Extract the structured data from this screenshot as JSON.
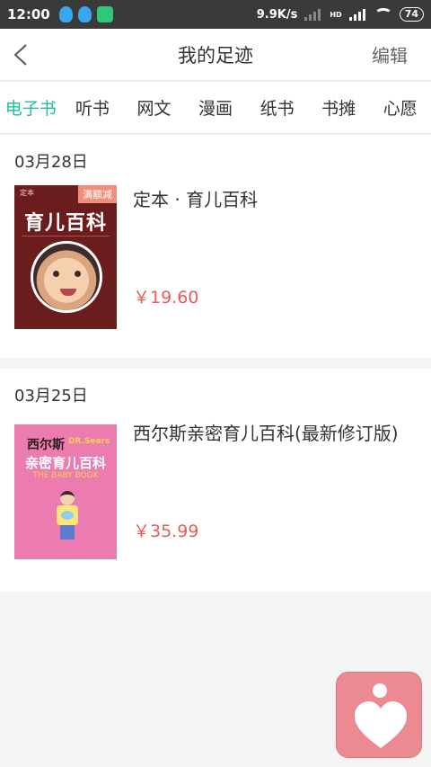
{
  "status": {
    "time": "12:00",
    "speed": "9.9K/s",
    "hd": "HD",
    "battery": "74"
  },
  "nav": {
    "title": "我的足迹",
    "edit": "编辑"
  },
  "tabs": [
    {
      "label": "电子书"
    },
    {
      "label": "听书"
    },
    {
      "label": "网文"
    },
    {
      "label": "漫画"
    },
    {
      "label": "纸书"
    },
    {
      "label": "书摊"
    },
    {
      "label": "心愿"
    }
  ],
  "history": [
    {
      "date": "03月28日",
      "title": "定本 · 育儿百科",
      "price": "￥19.60",
      "cover": {
        "badge": "满额减",
        "small_text": "定本",
        "cover_title": "育儿百科"
      }
    },
    {
      "date": "03月25日",
      "title": "西尔斯亲密育儿百科(最新修订版)",
      "price": "￥35.99",
      "cover": {
        "line1": "西尔斯",
        "line1b": "DR.Sears",
        "line2": "亲密育儿百科",
        "line3": "THE BABY BOOK"
      }
    }
  ],
  "colors": {
    "accent": "#1fbf9f",
    "price": "#e85b57",
    "fab": "#ec8a92"
  }
}
